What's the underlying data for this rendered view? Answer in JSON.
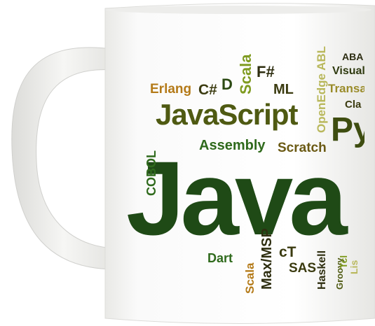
{
  "words": [
    {
      "id": "java",
      "text": "Java",
      "color": "#1f4a16"
    },
    {
      "id": "javascript",
      "text": "JavaScript",
      "color": "#4f5a12"
    },
    {
      "id": "python",
      "text": "Pyt",
      "color": "#3e4d10"
    },
    {
      "id": "assembly",
      "text": "Assembly",
      "color": "#2f6a1c"
    },
    {
      "id": "scratch",
      "text": "Scratch",
      "color": "#6b5a14"
    },
    {
      "id": "erlang",
      "text": "Erlang",
      "color": "#b47a18"
    },
    {
      "id": "csharp",
      "text": "C#",
      "color": "#3b3b10"
    },
    {
      "id": "d",
      "text": "D",
      "color": "#2c4a13"
    },
    {
      "id": "scala_top",
      "text": "Scala",
      "color": "#7f9b20"
    },
    {
      "id": "fsharp",
      "text": "F#",
      "color": "#2e2e10"
    },
    {
      "id": "ml",
      "text": "ML",
      "color": "#3b3b10"
    },
    {
      "id": "openedge",
      "text": "OpenEdge ABL",
      "color": "#b9b85c"
    },
    {
      "id": "abap",
      "text": "ABA",
      "color": "#2b2b10"
    },
    {
      "id": "visualb",
      "text": "Visual B",
      "color": "#2f3a10"
    },
    {
      "id": "transact",
      "text": "Transa",
      "color": "#9a8c2a"
    },
    {
      "id": "clarion",
      "text": "Cla",
      "color": "#3b3b10"
    },
    {
      "id": "cobol",
      "text": "COBOL",
      "color": "#2f6a1c"
    },
    {
      "id": "dart",
      "text": "Dart",
      "color": "#2f6a1c"
    },
    {
      "id": "scala_bottom",
      "text": "Scala",
      "color": "#b47a18"
    },
    {
      "id": "maxmsp",
      "text": "Max/MSP",
      "color": "#2e2e10"
    },
    {
      "id": "ct",
      "text": "cT",
      "color": "#3b3b10"
    },
    {
      "id": "sas",
      "text": "SAS",
      "color": "#3b3b10"
    },
    {
      "id": "haskell",
      "text": "Haskell",
      "color": "#2e2e10"
    },
    {
      "id": "groovy",
      "text": "Groovy",
      "color": "#4f5a12"
    },
    {
      "id": "tcl",
      "text": "Tcl",
      "color": "#7f9b20"
    },
    {
      "id": "lisp",
      "text": "Lis",
      "color": "#b9b85c"
    }
  ],
  "mug": {
    "body_color": "#f6f6f4",
    "handle_color": "#f1f1ef",
    "shadow_color": "#d9d9d6"
  }
}
